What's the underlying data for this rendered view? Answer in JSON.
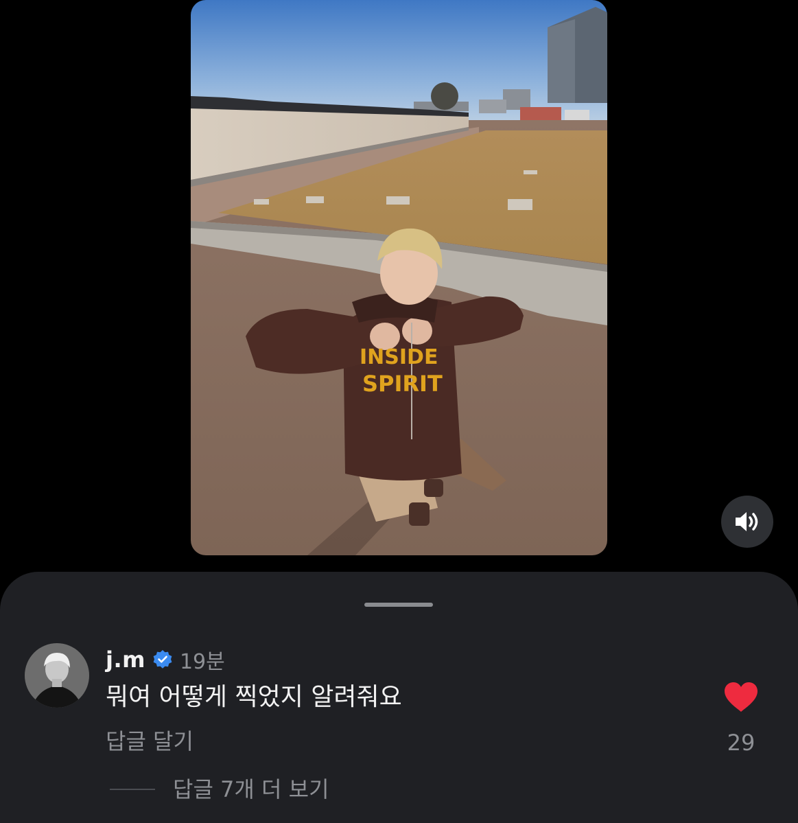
{
  "video": {
    "shirt_text_line1": "INSIDE",
    "shirt_text_line2": "SPIRIT",
    "sound_icon": "speaker-on-icon"
  },
  "comment": {
    "username": "j.m",
    "verified_icon": "verified-badge-icon",
    "timestamp": "19분",
    "text": "뭐여 어떻게 찍었지 알려줘요",
    "reply_label": "답글 달기",
    "like_icon": "heart-filled-icon",
    "like_count": "29",
    "more_replies_label": "답글 7개 더 보기"
  },
  "colors": {
    "background": "#000000",
    "sheet": "#1f2024",
    "primary_text": "#f2f2f2",
    "secondary_text": "#8e9095",
    "heart": "#ee2b3f",
    "verified": "#3b8bf0"
  }
}
